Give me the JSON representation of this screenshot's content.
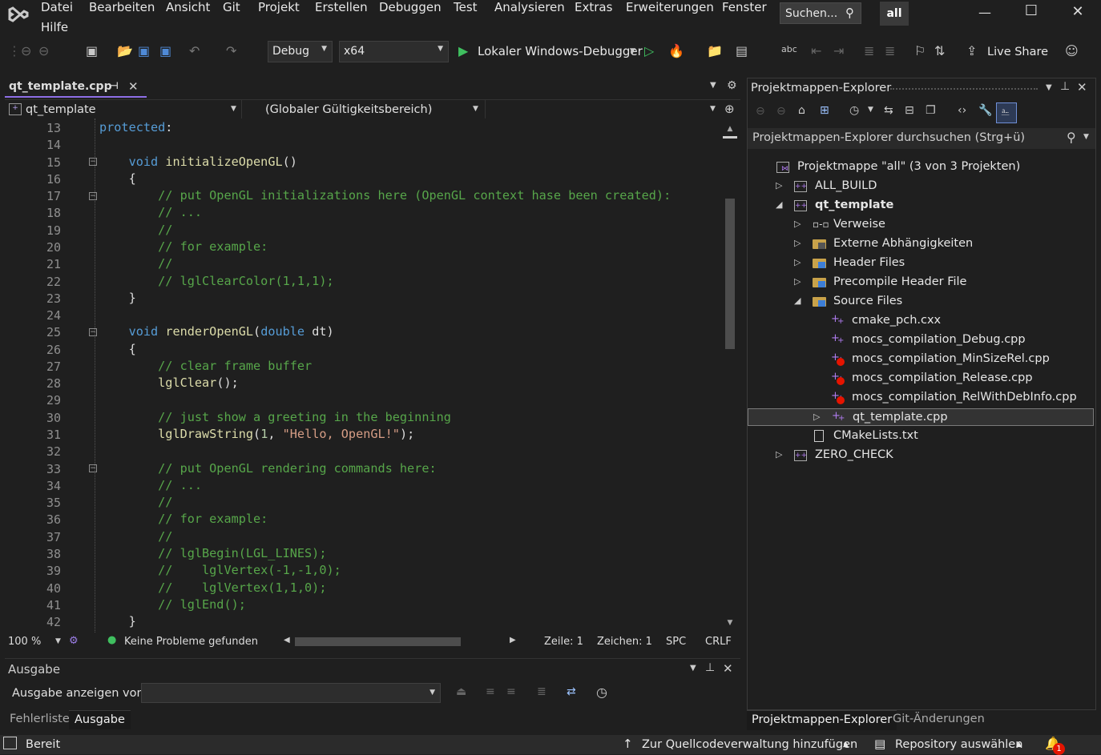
{
  "menu": [
    "Datei",
    "Bearbeiten",
    "Ansicht",
    "Git",
    "Projekt",
    "Erstellen",
    "Debuggen",
    "Test",
    "Analysieren",
    "Extras",
    "Erweiterungen",
    "Fenster",
    "Hilfe"
  ],
  "search_label": "Suchen...",
  "solution_badge": "all",
  "toolbar": {
    "config": "Debug",
    "platform": "x64",
    "debugger": "Lokaler Windows-Debugger",
    "live_share": "Live Share"
  },
  "editor": {
    "tab_title": "qt_template.cpp",
    "nav_project": "qt_template",
    "nav_scope": "(Globaler Gültigkeitsbereich)",
    "line_numbers": [
      "13",
      "14",
      "15",
      "16",
      "17",
      "18",
      "19",
      "20",
      "21",
      "22",
      "23",
      "24",
      "25",
      "26",
      "27",
      "28",
      "29",
      "30",
      "31",
      "32",
      "33",
      "34",
      "35",
      "36",
      "37",
      "38",
      "39",
      "40",
      "41",
      "42"
    ],
    "lines": [
      [
        [
          "kw",
          "protected"
        ],
        [
          "",
          ""
        ],
        [
          "",
          ":"
        ]
      ],
      [],
      [
        [
          "",
          "    "
        ],
        [
          "kw",
          "void"
        ],
        [
          "",
          " "
        ],
        [
          "fn",
          "initializeOpenGL"
        ],
        [
          "",
          "()"
        ]
      ],
      [
        [
          "",
          "    {"
        ]
      ],
      [
        [
          "",
          "        "
        ],
        [
          "cm",
          "// put OpenGL initializations here (OpenGL context hase been created):"
        ]
      ],
      [
        [
          "",
          "        "
        ],
        [
          "cm",
          "// ..."
        ]
      ],
      [
        [
          "",
          "        "
        ],
        [
          "cm",
          "//"
        ]
      ],
      [
        [
          "",
          "        "
        ],
        [
          "cm",
          "// for example:"
        ]
      ],
      [
        [
          "",
          "        "
        ],
        [
          "cm",
          "//"
        ]
      ],
      [
        [
          "",
          "        "
        ],
        [
          "cm",
          "// lglClearColor(1,1,1);"
        ]
      ],
      [
        [
          "",
          "    }"
        ]
      ],
      [],
      [
        [
          "",
          "    "
        ],
        [
          "kw",
          "void"
        ],
        [
          "",
          " "
        ],
        [
          "fn",
          "renderOpenGL"
        ],
        [
          "",
          "("
        ],
        [
          "kw",
          "double"
        ],
        [
          "",
          " dt)"
        ]
      ],
      [
        [
          "",
          "    {"
        ]
      ],
      [
        [
          "",
          "        "
        ],
        [
          "cm",
          "// clear frame buffer"
        ]
      ],
      [
        [
          "",
          "        "
        ],
        [
          "fn",
          "lglClear"
        ],
        [
          "",
          "();"
        ]
      ],
      [],
      [
        [
          "",
          "        "
        ],
        [
          "cm",
          "// just show a greeting in the beginning"
        ]
      ],
      [
        [
          "",
          "        "
        ],
        [
          "fn",
          "lglDrawString"
        ],
        [
          "",
          "("
        ],
        [
          "num",
          "1"
        ],
        [
          "",
          ", "
        ],
        [
          "str",
          "\"Hello, OpenGL!\""
        ],
        [
          "",
          ");"
        ]
      ],
      [],
      [
        [
          "",
          "        "
        ],
        [
          "cm",
          "// put OpenGL rendering commands here:"
        ]
      ],
      [
        [
          "",
          "        "
        ],
        [
          "cm",
          "// ..."
        ]
      ],
      [
        [
          "",
          "        "
        ],
        [
          "cm",
          "//"
        ]
      ],
      [
        [
          "",
          "        "
        ],
        [
          "cm",
          "// for example:"
        ]
      ],
      [
        [
          "",
          "        "
        ],
        [
          "cm",
          "//"
        ]
      ],
      [
        [
          "",
          "        "
        ],
        [
          "cm",
          "// lglBegin(LGL_LINES);"
        ]
      ],
      [
        [
          "",
          "        "
        ],
        [
          "cm",
          "//    lglVertex(-1,-1,0);"
        ]
      ],
      [
        [
          "",
          "        "
        ],
        [
          "cm",
          "//    lglVertex(1,1,0);"
        ]
      ],
      [
        [
          "",
          "        "
        ],
        [
          "cm",
          "// lglEnd();"
        ]
      ],
      [
        [
          "",
          "    }"
        ]
      ]
    ],
    "zoom": "100 %",
    "problems": "Keine Probleme gefunden",
    "line_label": "Zeile: 1",
    "col_label": "Zeichen: 1",
    "whitespace": "SPC",
    "eol": "CRLF"
  },
  "output": {
    "title": "Ausgabe",
    "show_from": "Ausgabe anzeigen von:",
    "tabs": [
      "Fehlerliste",
      "Ausgabe"
    ]
  },
  "solution_explorer": {
    "title": "Projektmappen-Explorer",
    "search_placeholder": "Projektmappen-Explorer durchsuchen (Strg+ü)",
    "tree": [
      {
        "label": "Projektmappe \"all\" (3 von 3 Projekten)",
        "indent": 0,
        "exp": "",
        "icon": "solution-icon"
      },
      {
        "label": "ALL_BUILD",
        "indent": 1,
        "exp": "right",
        "icon": "project-icon"
      },
      {
        "label": "qt_template",
        "indent": 1,
        "exp": "down",
        "icon": "project-icon",
        "bold": true
      },
      {
        "label": "Verweise",
        "indent": 2,
        "exp": "right",
        "icon": "references-icon"
      },
      {
        "label": "Externe Abhängigkeiten",
        "indent": 2,
        "exp": "right",
        "icon": "external-deps-icon"
      },
      {
        "label": "Header Files",
        "indent": 2,
        "exp": "right",
        "icon": "filter-folder-icon"
      },
      {
        "label": "Precompile Header File",
        "indent": 2,
        "exp": "right",
        "icon": "filter-folder-icon"
      },
      {
        "label": "Source Files",
        "indent": 2,
        "exp": "down",
        "icon": "filter-folder-icon"
      },
      {
        "label": "cmake_pch.cxx",
        "indent": 3,
        "exp": "",
        "icon": "cpp-file-icon"
      },
      {
        "label": "mocs_compilation_Debug.cpp",
        "indent": 3,
        "exp": "",
        "icon": "cpp-file-icon"
      },
      {
        "label": "mocs_compilation_MinSizeRel.cpp",
        "indent": 3,
        "exp": "",
        "icon": "cpp-file-excluded-icon"
      },
      {
        "label": "mocs_compilation_Release.cpp",
        "indent": 3,
        "exp": "",
        "icon": "cpp-file-excluded-icon"
      },
      {
        "label": "mocs_compilation_RelWithDebInfo.cpp",
        "indent": 3,
        "exp": "",
        "icon": "cpp-file-excluded-icon"
      },
      {
        "label": "qt_template.cpp",
        "indent": 3,
        "exp": "right",
        "icon": "cpp-file-icon",
        "selected": true
      },
      {
        "label": "CMakeLists.txt",
        "indent": 2,
        "exp": "",
        "icon": "text-file-icon"
      },
      {
        "label": "ZERO_CHECK",
        "indent": 1,
        "exp": "right",
        "icon": "project-icon"
      }
    ],
    "bottom_tabs": [
      "Projektmappen-Explorer",
      "Git-Änderungen"
    ]
  },
  "statusbar": {
    "ready": "Bereit",
    "source_control": "Zur Quellcodeverwaltung hinzufügen",
    "repository": "Repository auswählen",
    "notifications": "1"
  },
  "colors": {
    "accent": "#8e6ee6",
    "keyword": "#569cd6",
    "function": "#dcdcaa",
    "comment": "#57a64a",
    "string": "#d69d85",
    "number": "#b5cea8",
    "error": "#e51400"
  }
}
